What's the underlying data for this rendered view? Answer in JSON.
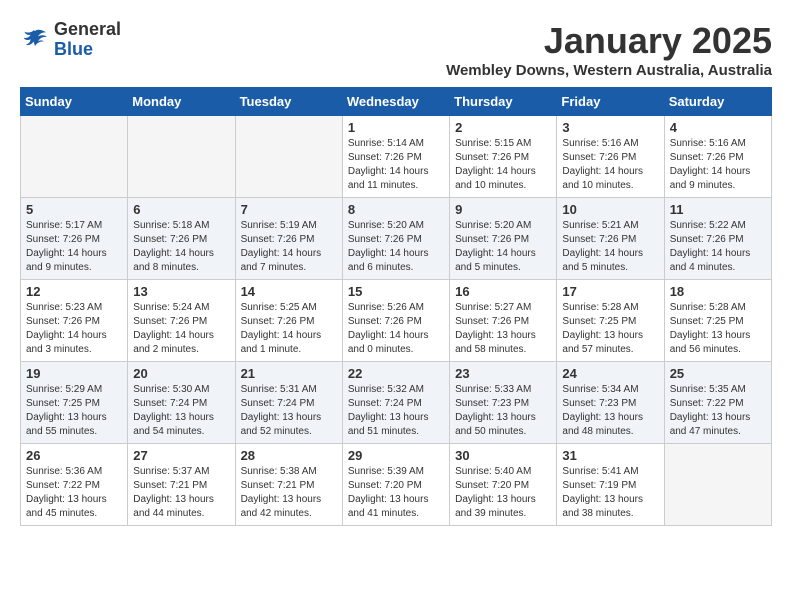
{
  "header": {
    "logo_line1": "General",
    "logo_line2": "Blue",
    "month_year": "January 2025",
    "location": "Wembley Downs, Western Australia, Australia"
  },
  "weekdays": [
    "Sunday",
    "Monday",
    "Tuesday",
    "Wednesday",
    "Thursday",
    "Friday",
    "Saturday"
  ],
  "weeks": [
    [
      {
        "day": "",
        "info": ""
      },
      {
        "day": "",
        "info": ""
      },
      {
        "day": "",
        "info": ""
      },
      {
        "day": "1",
        "info": "Sunrise: 5:14 AM\nSunset: 7:26 PM\nDaylight: 14 hours\nand 11 minutes."
      },
      {
        "day": "2",
        "info": "Sunrise: 5:15 AM\nSunset: 7:26 PM\nDaylight: 14 hours\nand 10 minutes."
      },
      {
        "day": "3",
        "info": "Sunrise: 5:16 AM\nSunset: 7:26 PM\nDaylight: 14 hours\nand 10 minutes."
      },
      {
        "day": "4",
        "info": "Sunrise: 5:16 AM\nSunset: 7:26 PM\nDaylight: 14 hours\nand 9 minutes."
      }
    ],
    [
      {
        "day": "5",
        "info": "Sunrise: 5:17 AM\nSunset: 7:26 PM\nDaylight: 14 hours\nand 9 minutes."
      },
      {
        "day": "6",
        "info": "Sunrise: 5:18 AM\nSunset: 7:26 PM\nDaylight: 14 hours\nand 8 minutes."
      },
      {
        "day": "7",
        "info": "Sunrise: 5:19 AM\nSunset: 7:26 PM\nDaylight: 14 hours\nand 7 minutes."
      },
      {
        "day": "8",
        "info": "Sunrise: 5:20 AM\nSunset: 7:26 PM\nDaylight: 14 hours\nand 6 minutes."
      },
      {
        "day": "9",
        "info": "Sunrise: 5:20 AM\nSunset: 7:26 PM\nDaylight: 14 hours\nand 5 minutes."
      },
      {
        "day": "10",
        "info": "Sunrise: 5:21 AM\nSunset: 7:26 PM\nDaylight: 14 hours\nand 5 minutes."
      },
      {
        "day": "11",
        "info": "Sunrise: 5:22 AM\nSunset: 7:26 PM\nDaylight: 14 hours\nand 4 minutes."
      }
    ],
    [
      {
        "day": "12",
        "info": "Sunrise: 5:23 AM\nSunset: 7:26 PM\nDaylight: 14 hours\nand 3 minutes."
      },
      {
        "day": "13",
        "info": "Sunrise: 5:24 AM\nSunset: 7:26 PM\nDaylight: 14 hours\nand 2 minutes."
      },
      {
        "day": "14",
        "info": "Sunrise: 5:25 AM\nSunset: 7:26 PM\nDaylight: 14 hours\nand 1 minute."
      },
      {
        "day": "15",
        "info": "Sunrise: 5:26 AM\nSunset: 7:26 PM\nDaylight: 14 hours\nand 0 minutes."
      },
      {
        "day": "16",
        "info": "Sunrise: 5:27 AM\nSunset: 7:26 PM\nDaylight: 13 hours\nand 58 minutes."
      },
      {
        "day": "17",
        "info": "Sunrise: 5:28 AM\nSunset: 7:25 PM\nDaylight: 13 hours\nand 57 minutes."
      },
      {
        "day": "18",
        "info": "Sunrise: 5:28 AM\nSunset: 7:25 PM\nDaylight: 13 hours\nand 56 minutes."
      }
    ],
    [
      {
        "day": "19",
        "info": "Sunrise: 5:29 AM\nSunset: 7:25 PM\nDaylight: 13 hours\nand 55 minutes."
      },
      {
        "day": "20",
        "info": "Sunrise: 5:30 AM\nSunset: 7:24 PM\nDaylight: 13 hours\nand 54 minutes."
      },
      {
        "day": "21",
        "info": "Sunrise: 5:31 AM\nSunset: 7:24 PM\nDaylight: 13 hours\nand 52 minutes."
      },
      {
        "day": "22",
        "info": "Sunrise: 5:32 AM\nSunset: 7:24 PM\nDaylight: 13 hours\nand 51 minutes."
      },
      {
        "day": "23",
        "info": "Sunrise: 5:33 AM\nSunset: 7:23 PM\nDaylight: 13 hours\nand 50 minutes."
      },
      {
        "day": "24",
        "info": "Sunrise: 5:34 AM\nSunset: 7:23 PM\nDaylight: 13 hours\nand 48 minutes."
      },
      {
        "day": "25",
        "info": "Sunrise: 5:35 AM\nSunset: 7:22 PM\nDaylight: 13 hours\nand 47 minutes."
      }
    ],
    [
      {
        "day": "26",
        "info": "Sunrise: 5:36 AM\nSunset: 7:22 PM\nDaylight: 13 hours\nand 45 minutes."
      },
      {
        "day": "27",
        "info": "Sunrise: 5:37 AM\nSunset: 7:21 PM\nDaylight: 13 hours\nand 44 minutes."
      },
      {
        "day": "28",
        "info": "Sunrise: 5:38 AM\nSunset: 7:21 PM\nDaylight: 13 hours\nand 42 minutes."
      },
      {
        "day": "29",
        "info": "Sunrise: 5:39 AM\nSunset: 7:20 PM\nDaylight: 13 hours\nand 41 minutes."
      },
      {
        "day": "30",
        "info": "Sunrise: 5:40 AM\nSunset: 7:20 PM\nDaylight: 13 hours\nand 39 minutes."
      },
      {
        "day": "31",
        "info": "Sunrise: 5:41 AM\nSunset: 7:19 PM\nDaylight: 13 hours\nand 38 minutes."
      },
      {
        "day": "",
        "info": ""
      }
    ]
  ]
}
